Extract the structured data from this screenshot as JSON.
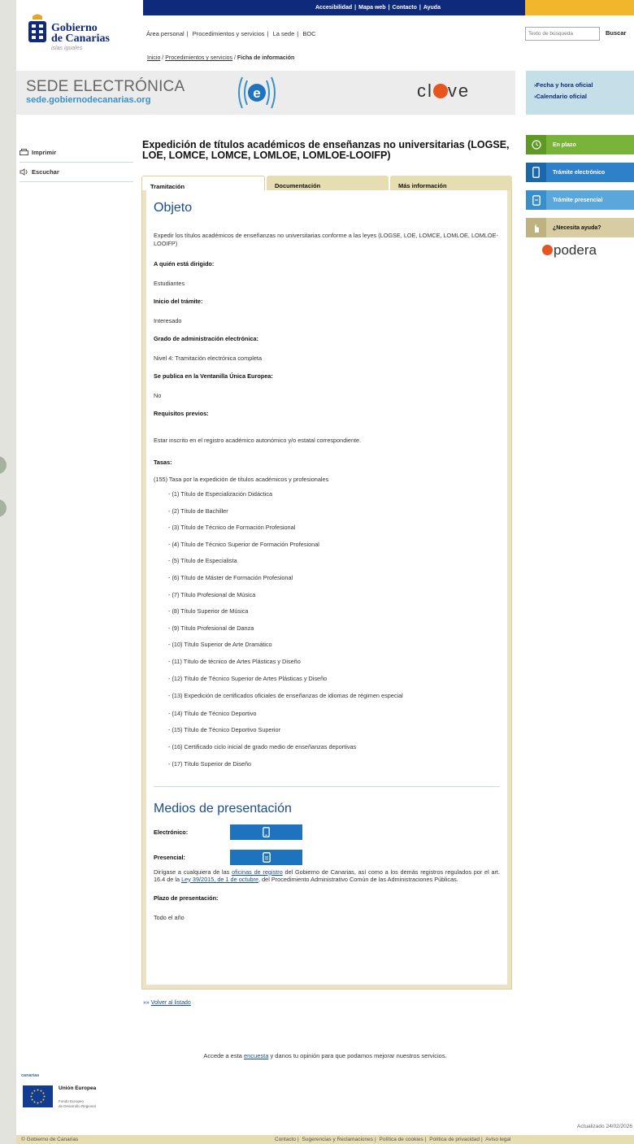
{
  "topbar": {
    "links": [
      "Accesibilidad",
      "Mapa web",
      "Contacto",
      "Ayuda"
    ]
  },
  "logo": {
    "line1": "Gobierno",
    "line2": "de Canarias",
    "line3": "islas iguales"
  },
  "nav": {
    "items": [
      "Área personal",
      "Procedimientos y servicios",
      "La sede",
      "BOC"
    ]
  },
  "search": {
    "placeholder": "Texto de búsqueda",
    "button_label": "Buscar"
  },
  "breadcrumb": {
    "items": [
      "Inicio",
      "Procedimientos y servicios"
    ],
    "current": "Ficha de información"
  },
  "banner": {
    "sede_title": "SEDE ELECTRÓNICA",
    "sede_url": "sede.gobiernodecanarias.org",
    "clave_pre": "cl",
    "clave_post": "ve"
  },
  "side_info": {
    "links": [
      "›Fecha y hora oficial",
      "›Calendario oficial"
    ]
  },
  "left_actions": {
    "print_label": "Imprimir",
    "listen_label": "Escuchar"
  },
  "page_title": "Expedición de títulos académicos de enseñanzas no universitarias (LOGSE, LOE, LOMCE, LOMCE, LOMLOE, LOMLOE-LOOIFP)",
  "tabs": [
    "Tramitación",
    "Documentación",
    "Más información"
  ],
  "objeto": {
    "heading": "Objeto",
    "description": "Expedir los títulos académicos de enseñanzas no universitarias conforme a las leyes (LOGSE, LOE, LOMCE, LOMLOE, LOMLOE-LOOIFP)",
    "fields": [
      {
        "label": "A quién está dirigido:",
        "value": "Estudiantes"
      },
      {
        "label": "Inicio del trámite:",
        "value": "Interesado"
      },
      {
        "label": "Grado de administración electrónica:",
        "value": "Nivel 4: Tramitación electrónica completa"
      },
      {
        "label": "Se publica en la Ventanilla Única Europea:",
        "value": "No"
      },
      {
        "label": "Requisitos previos:",
        "value": "Estar inscrito en el registro académico autonómico y/o estatal correspondiente."
      }
    ],
    "tasas_label": "Tasas:",
    "tasas_intro": "(155) Tasa por la expedición de títulos académicos y profesionales",
    "tasas": [
      "- (1) Título de Especialización Didáctica",
      "- (2) Título de Bachiller",
      "- (3) Título de Técnico de Formación Profesional",
      "- (4) Título de Técnico Superior de Formación Profesional",
      "- (5) Título de Especialista",
      "- (6) Título de Máster de Formación Profesional",
      "- (7) Título Profesional de Música",
      "- (8) Título Superior de Música",
      "- (9) Título Profesional de Danza",
      "- (10) Título Superior de Arte Dramático",
      "- (11) Título de técnico de Artes Plásticas y Diseño",
      "- (12) Título de Técnico Superior de Artes Plásticas y Diseño",
      "- (13) Expedición de certificados oficiales de enseñanzas de idiomas de régimen especial",
      "- (14) Título de Técnico Deportivo",
      "- (15) Título de Técnico Deportivo Superior",
      "- (16) Certificado ciclo inicial de grado medio de enseñanzas deportivas",
      "- (17) Título Superior de Diseño"
    ]
  },
  "medios": {
    "heading": "Medios de presentación",
    "electronico_label": "Electrónico:",
    "presencial_label": "Presencial:",
    "presencial_text_1": "Dirígase a cualquiera de las ",
    "presencial_link_1": "oficinas de registro",
    "presencial_text_2": " del Gobierno de Canarias, así como a los demás registros regulados por el art. 16.4 de la ",
    "presencial_link_2": "Ley 39/2015, de 1 de octubre",
    "presencial_text_3": ", del Procedimiento Administrativo Común de las Administraciones Públicas.",
    "plazo_label": "Plazo de presentación:",
    "plazo_value": "Todo el año"
  },
  "volver": {
    "prefix": "»»",
    "label": "Volver al listado"
  },
  "encuesta": {
    "text_1": "Accede a esta ",
    "link": "encuesta",
    "text_2": " y danos tu opinión para que podamos mejorar nuestros servicios."
  },
  "right_rail": {
    "buttons": [
      {
        "label": "En plazo",
        "icon": "clock-icon"
      },
      {
        "label": "Trámite electrónico",
        "icon": "phone-icon"
      },
      {
        "label": "Trámite presencial",
        "icon": "document-icon"
      },
      {
        "label": "¿Necesita ayuda?",
        "icon": "hand-icon"
      }
    ],
    "apodera_label": "podera"
  },
  "footer_logos": {
    "canarias_label": "canarias",
    "ue_title": "Unión Europea",
    "ue_sub_1": "Fondo Europeo",
    "ue_sub_2": "de Desarrollo Regional"
  },
  "updated": "Actualizado 24/02/2026",
  "footer": {
    "copyright": "© Gobierno de Canarias",
    "links": [
      "Contacto",
      "Sugerencias y Reclamaciones",
      "Política de cookies",
      "Política de privacidad",
      "Aviso legal"
    ]
  },
  "colors": {
    "navy": "#0f2a7a",
    "yellow": "#f0b72d",
    "khaki": "#e6ddb3",
    "blue_title": "#1a4e8a",
    "green": "#7ab33a",
    "blue": "#2e81c7",
    "light_blue": "#5ba7db",
    "orange": "#e8541f"
  }
}
